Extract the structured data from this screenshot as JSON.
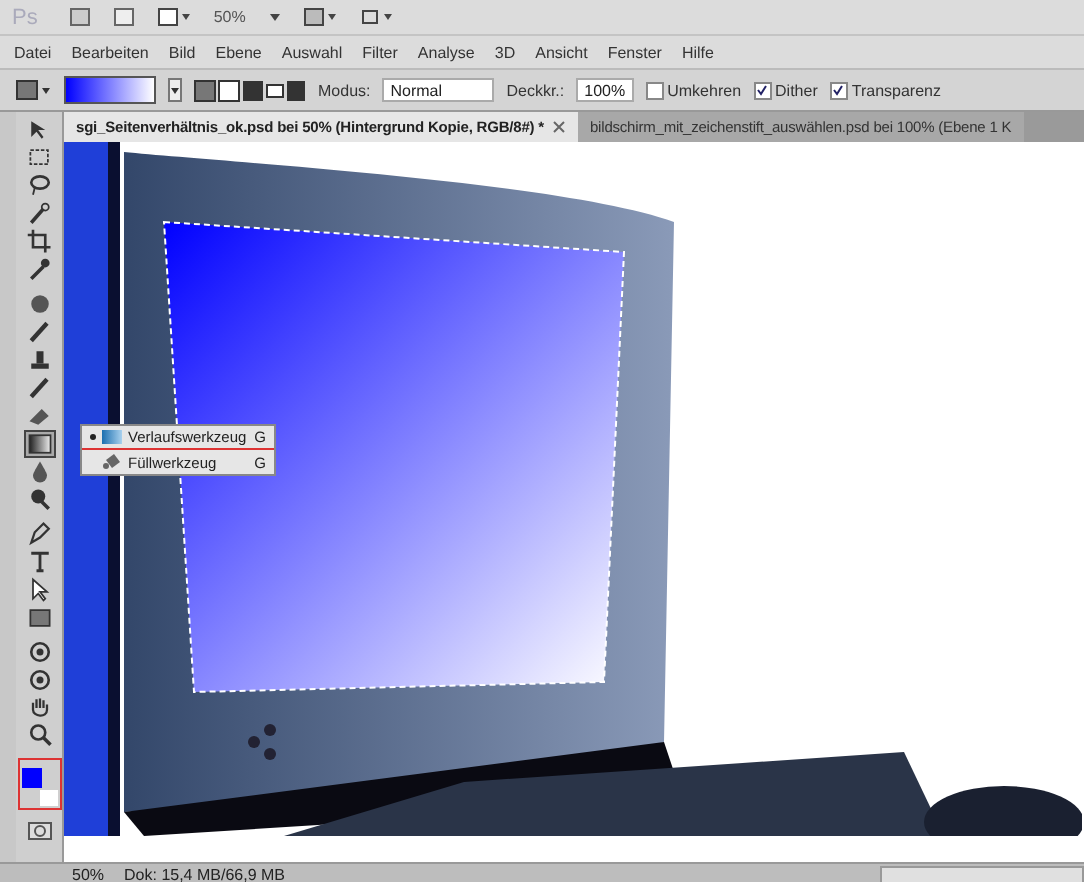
{
  "app_bar": {
    "logo": "Ps",
    "zoom": "50%"
  },
  "menu": [
    "Datei",
    "Bearbeiten",
    "Bild",
    "Ebene",
    "Auswahl",
    "Filter",
    "Analyse",
    "3D",
    "Ansicht",
    "Fenster",
    "Hilfe"
  ],
  "options": {
    "mode_label": "Modus:",
    "mode_value": "Normal",
    "opacity_label": "Deckkr.:",
    "opacity_value": "100%",
    "checkboxes": [
      {
        "label": "Umkehren",
        "checked": false
      },
      {
        "label": "Dither",
        "checked": true
      },
      {
        "label": "Transparenz",
        "checked": true
      }
    ]
  },
  "tabs": [
    {
      "label": "sgi_Seitenverhältnis_ok.psd bei 50% (Hintergrund Kopie, RGB/8#) *",
      "selected": true
    },
    {
      "label": "bildschirm_mit_zeichenstift_auswählen.psd bei 100% (Ebene 1 K",
      "selected": false
    }
  ],
  "tools": [
    {
      "kind": "move",
      "selected": false
    },
    {
      "kind": "marquee",
      "selected": false
    },
    {
      "kind": "lasso",
      "selected": false
    },
    {
      "kind": "wand",
      "selected": false
    },
    {
      "kind": "crop",
      "selected": false
    },
    {
      "kind": "eyedropper",
      "selected": false
    },
    {
      "kind": "heal",
      "selected": false
    },
    {
      "kind": "brush",
      "selected": false
    },
    {
      "kind": "stamp",
      "selected": false
    },
    {
      "kind": "brush",
      "selected": false
    },
    {
      "kind": "eraser",
      "selected": false
    },
    {
      "kind": "gradient",
      "selected": true
    },
    {
      "kind": "drop",
      "selected": false
    },
    {
      "kind": "dodge",
      "selected": false
    },
    {
      "kind": "pen",
      "selected": false
    },
    {
      "kind": "type",
      "selected": false
    },
    {
      "kind": "arrow",
      "selected": false
    },
    {
      "kind": "shape",
      "selected": false
    },
    {
      "kind": "rotate",
      "selected": false
    },
    {
      "kind": "rotate",
      "selected": false
    },
    {
      "kind": "hand",
      "selected": false
    },
    {
      "kind": "zoom",
      "selected": false
    }
  ],
  "flyout": [
    {
      "label": "Verlaufswerkzeug",
      "shortcut": "G",
      "selected": true
    },
    {
      "label": "Füllwerkzeug",
      "shortcut": "G",
      "selected": false
    }
  ],
  "swatches": [
    {
      "color": "#0000ff"
    },
    {
      "color": "#ffffff"
    }
  ],
  "status_bar": {
    "zoom": "50%",
    "document": "Dok: 15,4 MB/66,9 MB"
  }
}
